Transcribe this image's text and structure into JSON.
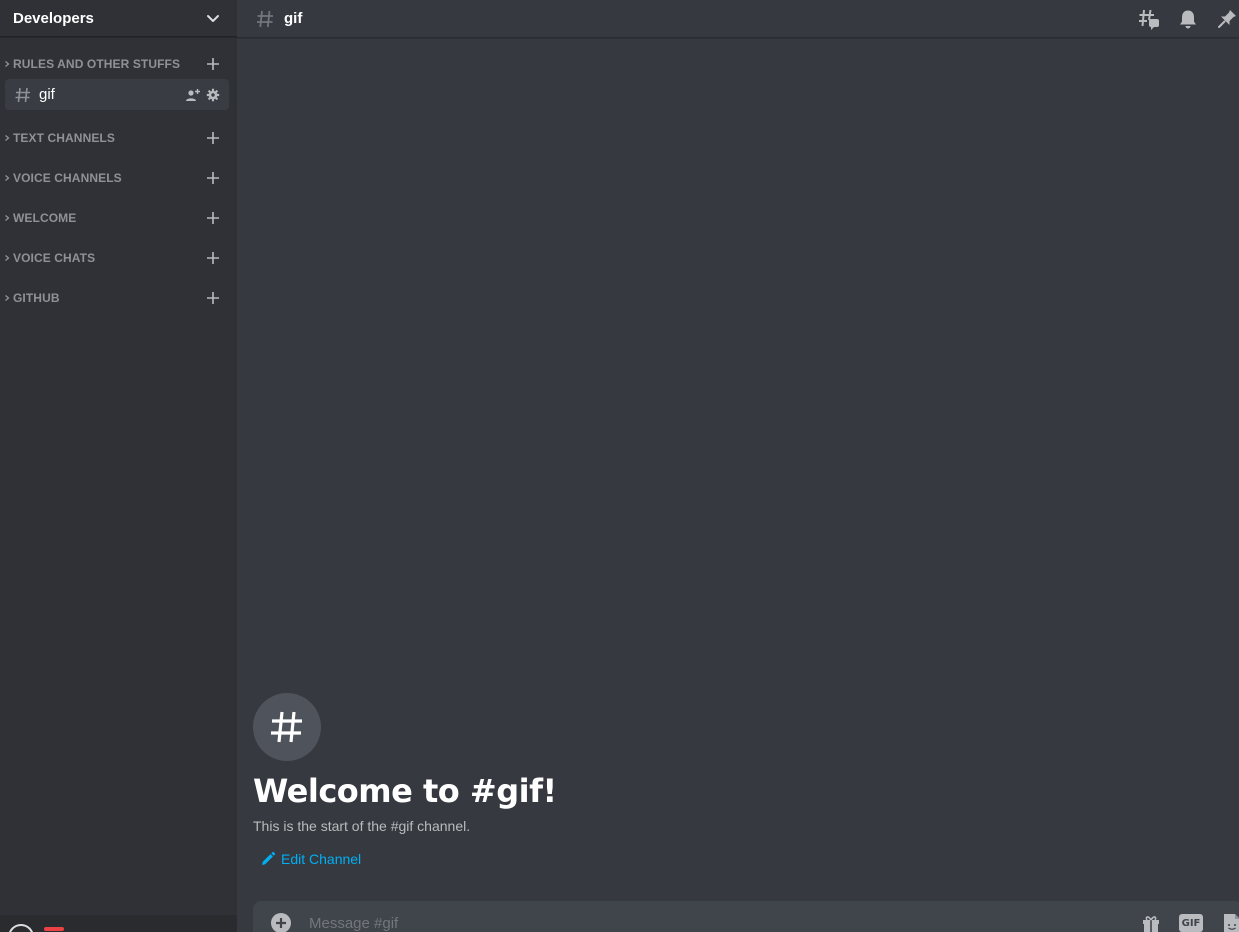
{
  "server": {
    "name": "Developers"
  },
  "sidebar": {
    "categories_top": [
      {
        "label": "RULES AND OTHER STUFFS"
      }
    ],
    "active_channel": {
      "name": "gif"
    },
    "categories": [
      {
        "label": "TEXT CHANNELS"
      },
      {
        "label": "VOICE CHANNELS"
      },
      {
        "label": "WELCOME"
      },
      {
        "label": "VOICE CHATS"
      },
      {
        "label": "GITHUB"
      }
    ]
  },
  "topbar": {
    "channel": "gif"
  },
  "welcome": {
    "title": "Welcome to #gif!",
    "subtitle": "This is the start of the #gif channel.",
    "edit_label": "Edit Channel"
  },
  "composer": {
    "placeholder": "Message #gif",
    "gif_label": "GIF"
  },
  "colors": {
    "sidebar_bg": "#2f3136",
    "main_bg": "#36393f",
    "accent_link": "#00aff4",
    "muted_text": "#8e9297"
  },
  "icons": {
    "server_menu": "chevron-down-icon",
    "channel": "hash-icon",
    "invite": "add-user-icon",
    "settings": "gear-icon",
    "threads": "threads-icon",
    "notifications": "bell-icon",
    "pins": "pin-icon",
    "edit": "pencil-icon",
    "attach": "plus-circle-icon",
    "gift": "gift-icon",
    "sticker": "sticker-icon"
  }
}
